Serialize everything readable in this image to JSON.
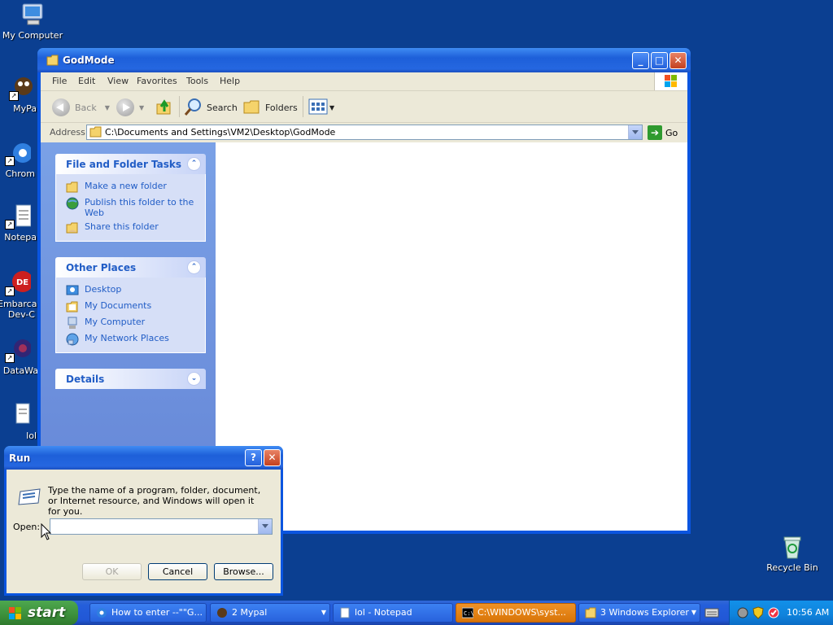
{
  "desktop": {
    "icons": [
      {
        "label": "My Computer",
        "icon": "my-computer-icon"
      },
      {
        "label": "MyPa",
        "icon": "mypal-icon"
      },
      {
        "label": "Chrom",
        "icon": "chrome-icon"
      },
      {
        "label": "Notepa",
        "icon": "notepad-icon"
      },
      {
        "label": "Embarca",
        "label2": "Dev-C",
        "icon": "devcpp-icon"
      },
      {
        "label": "DataWa",
        "icon": "datawave-icon"
      },
      {
        "label": "lol",
        "icon": "text-file-icon"
      },
      {
        "label": "Recycle Bin",
        "icon": "recycle-bin-icon"
      }
    ]
  },
  "explorer": {
    "title": "GodMode",
    "menu": [
      "File",
      "Edit",
      "View",
      "Favorites",
      "Tools",
      "Help"
    ],
    "toolbar": {
      "back": "Back",
      "search": "Search",
      "folders": "Folders"
    },
    "address": {
      "label": "Address",
      "value": "C:\\Documents and Settings\\VM2\\Desktop\\GodMode",
      "go": "Go"
    },
    "panels": {
      "tasks": {
        "title": "File and Folder Tasks",
        "items": [
          "Make a new folder",
          "Publish this folder to the Web",
          "Share this folder"
        ]
      },
      "places": {
        "title": "Other Places",
        "items": [
          "Desktop",
          "My Documents",
          "My Computer",
          "My Network Places"
        ]
      },
      "details": {
        "title": "Details"
      }
    }
  },
  "run": {
    "title": "Run",
    "description": "Type the name of a program, folder, document, or Internet resource, and Windows will open it for you.",
    "open_label": "Open:",
    "open_value": "",
    "ok": "OK",
    "cancel": "Cancel",
    "browse": "Browse..."
  },
  "taskbar": {
    "start": "start",
    "tasks": [
      {
        "label": "How to enter --\"\"G...",
        "icon": "chrome-icon"
      },
      {
        "label": "2 Mypal",
        "icon": "mypal-icon"
      },
      {
        "label": "lol - Notepad",
        "icon": "notepad-icon"
      },
      {
        "label": "C:\\WINDOWS\\syst...",
        "icon": "cmd-icon",
        "active": true
      },
      {
        "label": "3 Windows Explorer",
        "icon": "folder-icon"
      }
    ],
    "clock": "10:56 AM"
  },
  "colors": {
    "desktop": "#0b3f91",
    "titlebar": "#245edb",
    "link": "#215dc6",
    "start": "#3c8f3a"
  }
}
